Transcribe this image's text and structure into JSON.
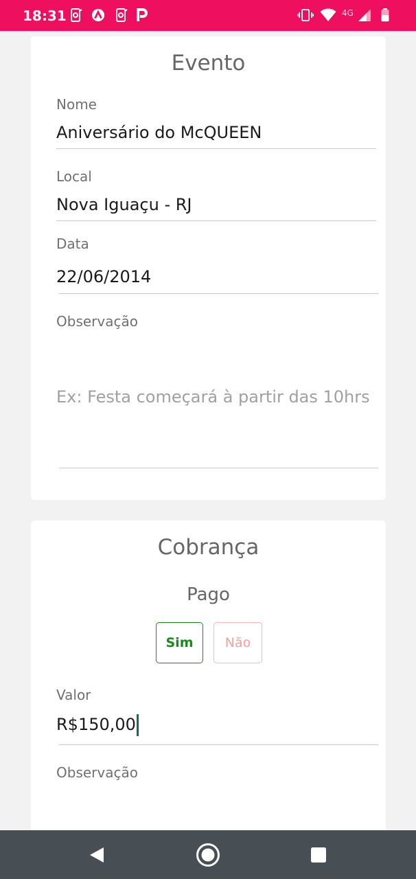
{
  "status_bar": {
    "time": "18:31",
    "network_type": "4G",
    "background_color": "#ee0f5e",
    "icons": [
      "screen-record-icon",
      "app-a-icon",
      "screen-record-icon",
      "app-p-icon",
      "vibrate-icon",
      "wifi-icon",
      "signal-icon",
      "battery-icon"
    ]
  },
  "event": {
    "title": "Evento",
    "name_label": "Nome",
    "name_value": "Aniversário do McQUEEN",
    "local_label": "Local",
    "local_value": "Nova Iguaçu - RJ",
    "date_label": "Data",
    "date_value": "22/06/2014",
    "obs_label": "Observação",
    "obs_placeholder": "Ex: Festa começará à partir das 10hrs"
  },
  "charge": {
    "title": "Cobrança",
    "paid_label": "Pago",
    "yes_label": "Sim",
    "no_label": "Não",
    "paid_selected": "Sim",
    "value_label": "Valor",
    "value": "R$150,00",
    "obs_label": "Observação",
    "yes_color": "#1a8a1a",
    "no_color": "#f3a0a0"
  },
  "nav_bar": {
    "background_color": "#474f55",
    "icons": [
      "back-icon",
      "home-icon",
      "recents-icon"
    ]
  }
}
